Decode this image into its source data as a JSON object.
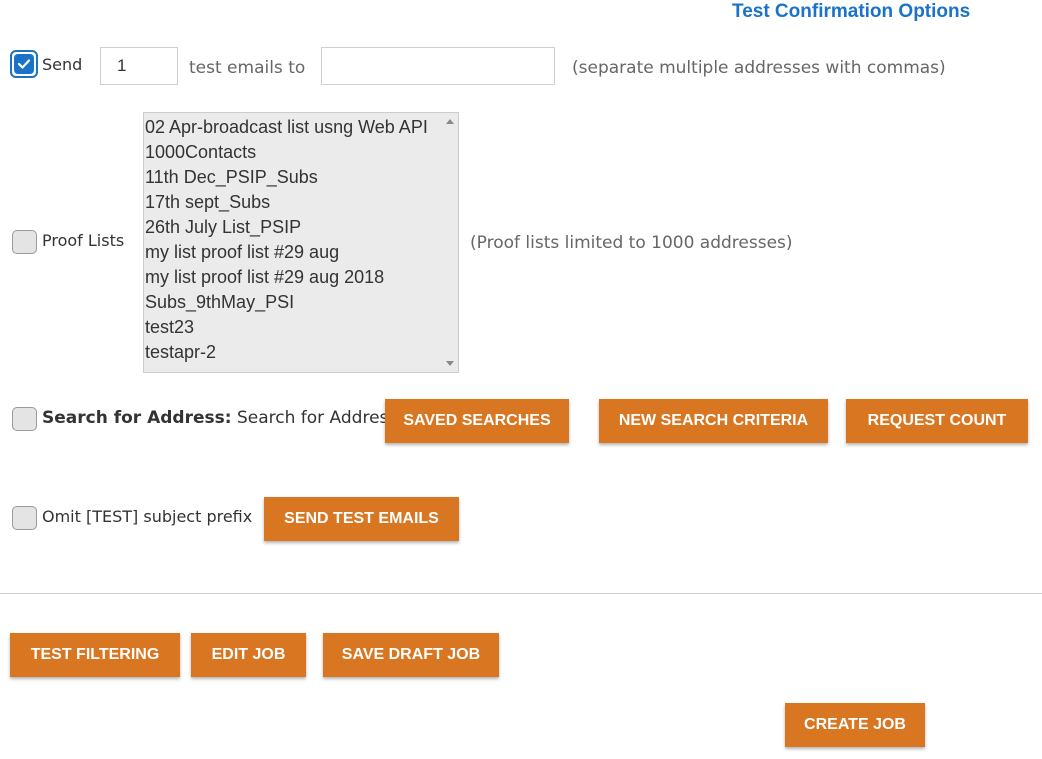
{
  "header": {
    "title": "Test Confirmation Options"
  },
  "send": {
    "checked": true,
    "label": "Send",
    "count_value": "1",
    "middle_text": "test emails to",
    "email_value": "",
    "hint": "(separate multiple addresses with commas)"
  },
  "proof_lists": {
    "checked": false,
    "label": "Proof Lists",
    "options": [
      "02 Apr-broadcast list usng Web API",
      "1000Contacts",
      "11th Dec_PSIP_Subs",
      "17th sept_Subs",
      "26th July List_PSIP",
      "my list proof list #29 aug",
      "my list proof list #29 aug 2018",
      "Subs_9thMay_PSI",
      "test23",
      "testapr-2"
    ],
    "hint": "(Proof lists limited to 1000 addresses)"
  },
  "search": {
    "checked": false,
    "label_bold": "Search for Address:",
    "label_normal": "Search for Address",
    "saved_searches_label": "SAVED SEARCHES",
    "new_search_label": "NEW SEARCH CRITERIA",
    "request_count_label": "REQUEST COUNT"
  },
  "omit": {
    "checked": false,
    "label": "Omit [TEST] subject prefix",
    "send_test_label": "SEND TEST EMAILS"
  },
  "footer": {
    "test_filtering_label": "TEST FILTERING",
    "edit_job_label": "EDIT JOB",
    "save_draft_label": "SAVE DRAFT JOB",
    "create_job_label": "CREATE JOB"
  },
  "colors": {
    "accent_blue": "#1a73c8",
    "button_orange": "#d97621"
  }
}
